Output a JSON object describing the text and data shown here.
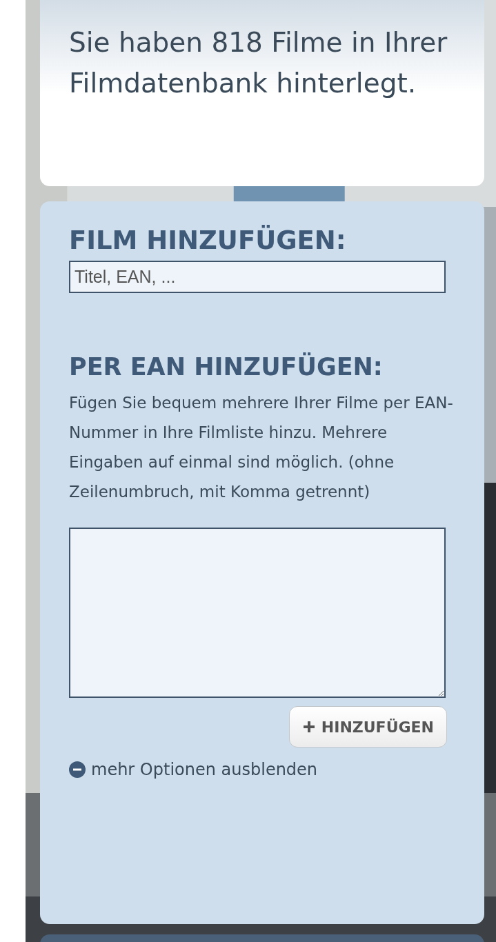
{
  "summary": "Sie haben 818 Filme in Ihrer Filmdatenbank hinterlegt.",
  "add_film": {
    "heading": "FILM HINZUFÜGEN:",
    "search": {
      "placeholder": "Titel, EAN, ..."
    }
  },
  "add_by_ean": {
    "heading": "PER EAN HINZUFÜGEN:",
    "description": "Fügen Sie bequem mehrere Ihrer Filme per EAN-Nummer in Ihre Filmliste hinzu. Mehrere Eingaben auf einmal sind möglich. (ohne Zeilenumbruch, mit Komma getrennt)",
    "button": {
      "label": "HINZUFÜGEN"
    }
  },
  "options_toggle": {
    "label": "mehr Optionen ausblenden",
    "expanded": true
  }
}
